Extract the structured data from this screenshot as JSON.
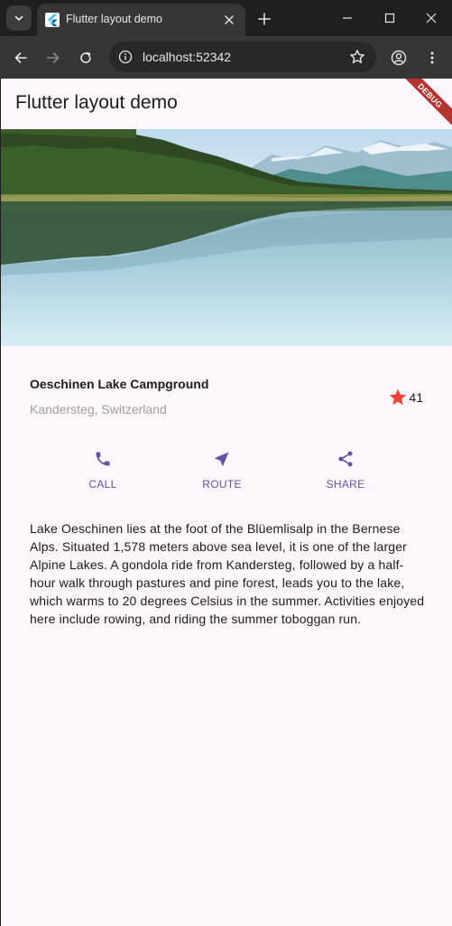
{
  "browser": {
    "tab_title": "Flutter layout demo",
    "url": "localhost:52342",
    "icons": [
      "tab-list-icon",
      "flutter-logo-icon",
      "close-icon",
      "plus-icon",
      "minimize-icon",
      "maximize-icon",
      "close-window-icon",
      "back-arrow-icon",
      "forward-arrow-icon",
      "reload-icon",
      "site-info-icon",
      "bookmark-star-icon",
      "profile-icon",
      "kebab-menu-icon"
    ]
  },
  "app": {
    "title": "Flutter layout demo",
    "debug_banner": "DEBUG",
    "colors": {
      "background": "#fdf6fc",
      "accent": "#6750a4",
      "star": "#f44336",
      "subtitle": "#9e9e9e"
    }
  },
  "place": {
    "name": "Oeschinen Lake Campground",
    "location": "Kandersteg, Switzerland",
    "rating": "41"
  },
  "actions": [
    {
      "label": "CALL",
      "icon": "phone-icon"
    },
    {
      "label": "ROUTE",
      "icon": "navigation-icon"
    },
    {
      "label": "SHARE",
      "icon": "share-icon"
    }
  ],
  "description": "Lake Oeschinen lies at the foot of the Blüemlisalp in the Bernese Alps. Situated 1,578 meters above sea level, it is one of the larger Alpine Lakes. A gondola ride from Kandersteg, followed by a half-hour walk through pastures and pine forest, leads you to the lake, which warms to 20 degrees Celsius in the summer. Activities enjoyed here include rowing, and riding the summer toboggan run."
}
